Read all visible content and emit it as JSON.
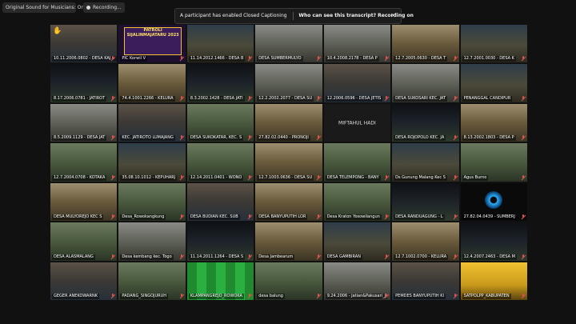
{
  "topbar": {
    "app_label": "Original Sound for Musicians: On",
    "recording_label": "Recording..."
  },
  "notice": {
    "message": "A participant has enabled Closed Captioning",
    "link": "Who can see this transcript? Recording on"
  },
  "tiles": [
    {
      "label": "10.11.2006.0802 - DESA KAJAR",
      "scene": "person",
      "hand": true
    },
    {
      "label": "PIC Korwil V",
      "scene": "poster",
      "poster": "PATROLI SIJALINMAJATARU 2023"
    },
    {
      "label": "11.14.2012.1466 - DESA B",
      "scene": "outdoor"
    },
    {
      "label": "DESA SUMBERMULYO",
      "scene": "room"
    },
    {
      "label": "10.4.2008.2178 - DESA P",
      "scene": "room"
    },
    {
      "label": "12.7.2005.0630 - DESA T",
      "scene": "hall"
    },
    {
      "label": "12.7.2001.0030 - DESA K",
      "scene": "outdoor"
    },
    {
      "label": "8.17.2006.0781 - JATIROT",
      "scene": "night"
    },
    {
      "label": "74.4.1001.2266 - KELURA",
      "scene": "hall"
    },
    {
      "label": "8.3.2002.1428 - DESA JATI",
      "scene": "night"
    },
    {
      "label": "12.2.2002.2077 - DESA SU",
      "scene": "room"
    },
    {
      "label": "12.2006.0596 - DESA JETIS",
      "scene": "person"
    },
    {
      "label": "DESA SUKOSARI KEC. JAT",
      "scene": "room"
    },
    {
      "label": "PENANGGAL CANDIPUR",
      "scene": "outdoor"
    },
    {
      "label": "8.5.2009.1129 - DESA JAT",
      "scene": "room"
    },
    {
      "label": "KEC. JATIROTO LUMAJANG",
      "scene": "person"
    },
    {
      "label": "DESA SUKOKATAR, KEC. S",
      "scene": "group"
    },
    {
      "label": "27.82.02.0440 - PRONOJI",
      "scene": "hall"
    },
    {
      "label": "MIFTAHUL HADI",
      "scene": "blank"
    },
    {
      "label": "DESA ROJOPOLO KEC. JA",
      "scene": "night"
    },
    {
      "label": "8.13.2002.1803 - DESA P",
      "scene": "hall"
    },
    {
      "label": "12.7.2004.0708 - KOTAKA",
      "scene": "group"
    },
    {
      "label": "35.08.10.1012 - KEPUHARJ",
      "scene": "outdoor"
    },
    {
      "label": "12.14.2011.0401 - WONO",
      "scene": "group"
    },
    {
      "label": "12.7.1003.0636 - DESA SU",
      "scene": "hall"
    },
    {
      "label": "DESA TELEMPONG - BANY",
      "scene": "group"
    },
    {
      "label": "Ds Gunung Malang Kec S",
      "scene": "outdoor"
    },
    {
      "label": "Agus Burno",
      "scene": "group"
    },
    {
      "label": "DESA MULYOREJO KEC S",
      "scene": "hall"
    },
    {
      "label": "Desa_Rowokangkung",
      "scene": "group"
    },
    {
      "label": "DESA BUDIAN KEC. SUB",
      "scene": "person"
    },
    {
      "label": "DESA BANYUPUTIH LOR",
      "scene": "hall"
    },
    {
      "label": "Desa Kraton Yosowilangun",
      "scene": "group"
    },
    {
      "label": "DESA RANDUAGUNG - L",
      "scene": "night"
    },
    {
      "label": "27.82.04.0439 - SUMBERJ",
      "scene": "eye"
    },
    {
      "label": "DESA ALASMALANG",
      "scene": "group"
    },
    {
      "label": "Desa kembang kec. Togo",
      "scene": "room"
    },
    {
      "label": "11.14.2011.1264 - DESA S",
      "scene": "night"
    },
    {
      "label": "Desa Jambearum",
      "scene": "hall"
    },
    {
      "label": "DESA GAMBIRAN",
      "scene": "outdoor"
    },
    {
      "label": "12.7.1002.0700 - KELURA",
      "scene": "hall"
    },
    {
      "label": "12.4.2007.2463 - DESA M",
      "scene": "night"
    },
    {
      "label": "GEGER ANEKOWARNK",
      "scene": "person"
    },
    {
      "label": "PADANG_SINGOJURUH",
      "scene": "group"
    },
    {
      "label": "KLAMPANGREJO_ROWOKA",
      "scene": "green"
    },
    {
      "label": "desa balung",
      "scene": "group"
    },
    {
      "label": "9.24.2006 - Jatian&Pakusari_J",
      "scene": "room"
    },
    {
      "label": "PEMDES BANYUPUTIH KI",
      "scene": "person"
    },
    {
      "label": "SATPOLPP_KABUPATEN",
      "scene": "yellow"
    }
  ]
}
